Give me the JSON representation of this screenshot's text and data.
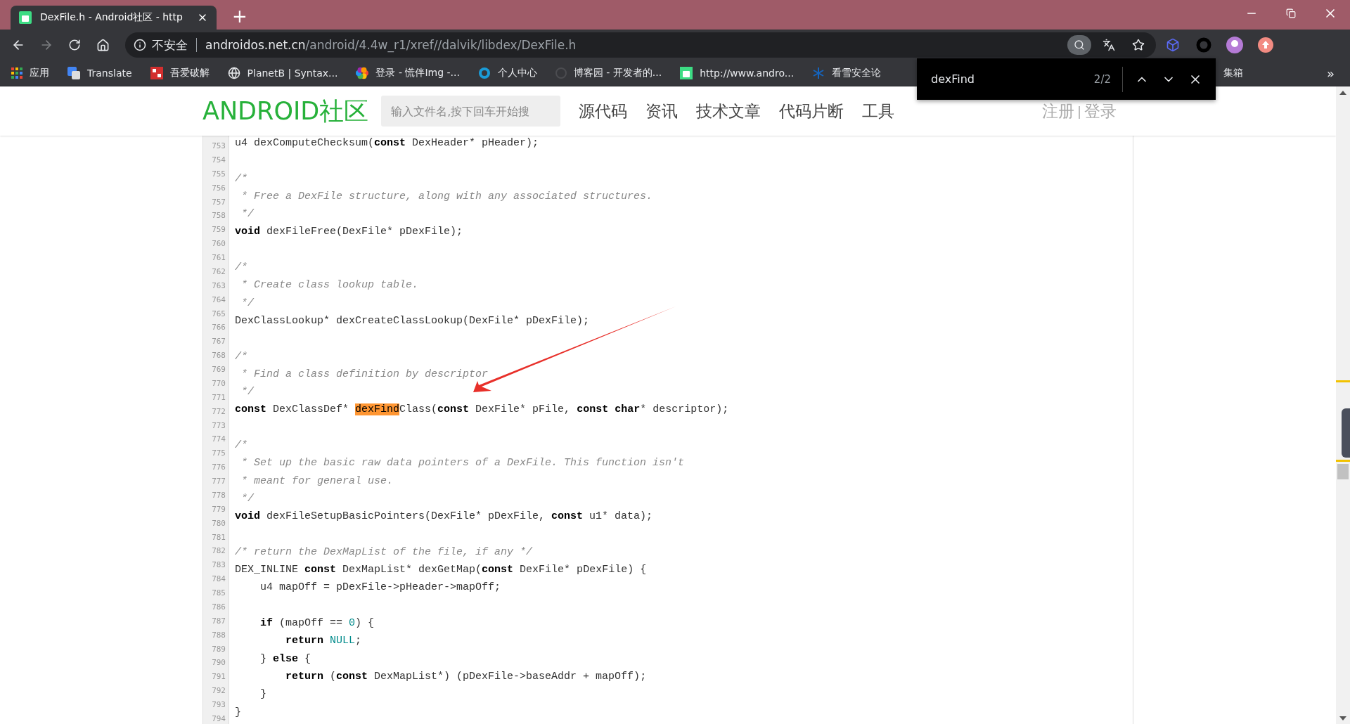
{
  "browser": {
    "tab": {
      "title": "DexFile.h - Android社区 - http",
      "selected": true
    },
    "new_tab": "+",
    "nav_buttons": [
      {
        "kind": "back",
        "disabled": false
      },
      {
        "kind": "forward",
        "disabled": true
      },
      {
        "kind": "reload",
        "disabled": false
      },
      {
        "kind": "home",
        "disabled": false
      }
    ],
    "url": {
      "security": "不安全",
      "host": "androidos.net.cn",
      "path": "/android/4.4w_r1/xref//dalvik/libdex/DexFile.h"
    },
    "bookmarks": [
      {
        "label": "应用",
        "kind": "apps"
      },
      {
        "label": "Translate",
        "kind": "translate"
      },
      {
        "label": "吾爱破解",
        "kind": "seal"
      },
      {
        "label": "PlanetB | Syntax...",
        "kind": "globe"
      },
      {
        "label": "登录 - 慌伴Img -...",
        "kind": "flower"
      },
      {
        "label": "个人中心",
        "kind": "ring"
      },
      {
        "label": "博客园 - 开发者的...",
        "kind": "faint"
      },
      {
        "label": "http://www.andro...",
        "kind": "android"
      },
      {
        "label": "看雪安全论",
        "kind": "snow"
      }
    ],
    "bookmark_after": "集箱",
    "bookmarks_more": "»"
  },
  "find_bar": {
    "query": "dexFind",
    "count": "2/2"
  },
  "site": {
    "logo": "ANDROID社区",
    "search": {
      "placeholder": "输入文件名,按下回车开始搜"
    },
    "nav": [
      "源代码",
      "资讯",
      "技术文章",
      "代码片断",
      "工具"
    ],
    "auth": [
      "注册",
      "登录"
    ],
    "auth_separator": "|"
  },
  "code": {
    "line_numbers": [
      "753",
      "754",
      "755",
      "756",
      "757",
      "758",
      "759",
      "760",
      "761",
      "762",
      "763",
      "764",
      "765",
      "766",
      "767",
      "768",
      "769",
      "770",
      "771",
      "772",
      "773",
      "774",
      "775",
      "776",
      "777",
      "778",
      "779",
      "780",
      "781",
      "782",
      "783",
      "784",
      "785",
      "786",
      "787",
      "788",
      "789",
      "790",
      "791",
      "792",
      "793",
      "794"
    ],
    "lines": [
      {
        "kind": "code",
        "tokens": [
          {
            "text": "u4 dexComputeChecksum(",
            "kind": "plain"
          },
          {
            "text": "const",
            "kind": "keyword"
          },
          {
            "text": " DexHeader* pHeader);",
            "kind": "plain"
          }
        ]
      },
      {
        "kind": "blank"
      },
      {
        "kind": "code",
        "tokens": [
          {
            "text": "/*",
            "kind": "comment"
          }
        ]
      },
      {
        "kind": "code",
        "tokens": [
          {
            "text": " * Free a DexFile structure, along with any associated structures.",
            "kind": "comment"
          }
        ]
      },
      {
        "kind": "code",
        "tokens": [
          {
            "text": " */",
            "kind": "comment"
          }
        ]
      },
      {
        "kind": "code",
        "tokens": [
          {
            "text": "void",
            "kind": "keyword"
          },
          {
            "text": " dexFileFree(DexFile* pDexFile);",
            "kind": "plain"
          }
        ]
      },
      {
        "kind": "blank"
      },
      {
        "kind": "code",
        "tokens": [
          {
            "text": "/*",
            "kind": "comment"
          }
        ]
      },
      {
        "kind": "code",
        "tokens": [
          {
            "text": " * Create class lookup table.",
            "kind": "comment"
          }
        ]
      },
      {
        "kind": "code",
        "tokens": [
          {
            "text": " */",
            "kind": "comment"
          }
        ]
      },
      {
        "kind": "code",
        "tokens": [
          {
            "text": "DexClassLookup* dexCreateClassLookup(DexFile* pDexFile);",
            "kind": "plain"
          }
        ]
      },
      {
        "kind": "blank"
      },
      {
        "kind": "code",
        "tokens": [
          {
            "text": "/*",
            "kind": "comment"
          }
        ]
      },
      {
        "kind": "code",
        "tokens": [
          {
            "text": " * Find a class definition by descriptor",
            "kind": "comment"
          }
        ]
      },
      {
        "kind": "code",
        "tokens": [
          {
            "text": " */",
            "kind": "comment"
          }
        ]
      },
      {
        "kind": "code",
        "tokens": [
          {
            "text": "const",
            "kind": "keyword"
          },
          {
            "text": " DexClassDef* ",
            "kind": "plain"
          },
          {
            "text": "dexFind",
            "kind": "match"
          },
          {
            "text": "Class(",
            "kind": "plain"
          },
          {
            "text": "const",
            "kind": "keyword"
          },
          {
            "text": " DexFile* pFile, ",
            "kind": "plain"
          },
          {
            "text": "const char",
            "kind": "keyword"
          },
          {
            "text": "* descriptor);",
            "kind": "plain"
          }
        ]
      },
      {
        "kind": "blank"
      },
      {
        "kind": "code",
        "tokens": [
          {
            "text": "/*",
            "kind": "comment"
          }
        ]
      },
      {
        "kind": "code",
        "tokens": [
          {
            "text": " * Set up the basic raw data pointers of a DexFile. This function isn't",
            "kind": "comment"
          }
        ]
      },
      {
        "kind": "code",
        "tokens": [
          {
            "text": " * meant for general use.",
            "kind": "comment"
          }
        ]
      },
      {
        "kind": "code",
        "tokens": [
          {
            "text": " */",
            "kind": "comment"
          }
        ]
      },
      {
        "kind": "code",
        "tokens": [
          {
            "text": "void",
            "kind": "keyword"
          },
          {
            "text": " dexFileSetupBasicPointers(DexFile* pDexFile, ",
            "kind": "plain"
          },
          {
            "text": "const",
            "kind": "keyword"
          },
          {
            "text": " u1* data);",
            "kind": "plain"
          }
        ]
      },
      {
        "kind": "blank"
      },
      {
        "kind": "code",
        "tokens": [
          {
            "text": "/* return the DexMapList of the file, if any */",
            "kind": "comment"
          }
        ]
      },
      {
        "kind": "code",
        "tokens": [
          {
            "text": "DEX_INLINE ",
            "kind": "plain"
          },
          {
            "text": "const",
            "kind": "keyword"
          },
          {
            "text": " DexMapList* dexGetMap(",
            "kind": "plain"
          },
          {
            "text": "const",
            "kind": "keyword"
          },
          {
            "text": " DexFile* pDexFile) {",
            "kind": "plain"
          }
        ]
      },
      {
        "kind": "code",
        "tokens": [
          {
            "text": "    u4 mapOff = pDexFile->pHeader->mapOff;",
            "kind": "plain"
          }
        ]
      },
      {
        "kind": "blank"
      },
      {
        "kind": "code",
        "tokens": [
          {
            "text": "    if",
            "kind": "keyword"
          },
          {
            "text": " (mapOff == ",
            "kind": "plain"
          },
          {
            "text": "0",
            "kind": "number"
          },
          {
            "text": ") {",
            "kind": "plain"
          }
        ]
      },
      {
        "kind": "code",
        "tokens": [
          {
            "text": "        return",
            "kind": "keyword"
          },
          {
            "text": " NULL",
            "kind": "number"
          },
          {
            "text": ";",
            "kind": "plain"
          }
        ]
      },
      {
        "kind": "code",
        "tokens": [
          {
            "text": "    } ",
            "kind": "plain"
          },
          {
            "text": "else",
            "kind": "keyword"
          },
          {
            "text": " {",
            "kind": "plain"
          }
        ]
      },
      {
        "kind": "code",
        "tokens": [
          {
            "text": "        return",
            "kind": "keyword"
          },
          {
            "text": " (",
            "kind": "plain"
          },
          {
            "text": "const",
            "kind": "keyword"
          },
          {
            "text": " DexMapList*) (pDexFile->baseAddr + mapOff);",
            "kind": "plain"
          }
        ]
      },
      {
        "kind": "code",
        "tokens": [
          {
            "text": "    }",
            "kind": "plain"
          }
        ]
      },
      {
        "kind": "code",
        "tokens": [
          {
            "text": "}",
            "kind": "plain"
          }
        ]
      }
    ]
  }
}
